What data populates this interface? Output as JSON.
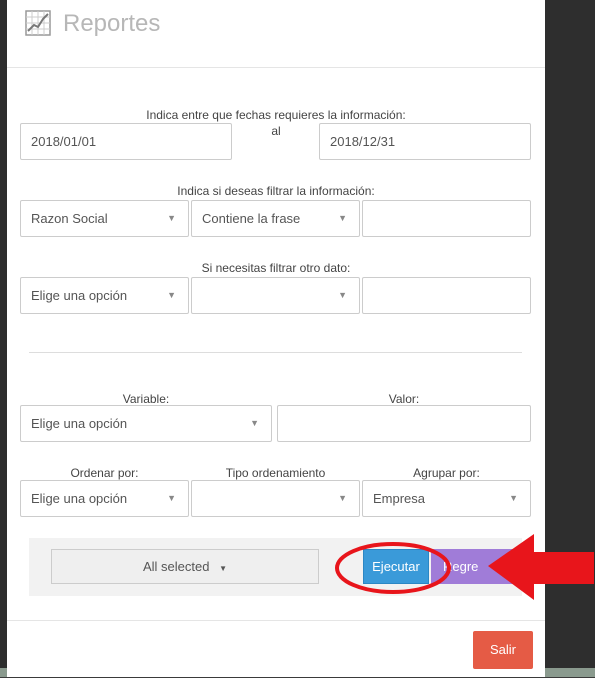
{
  "header": {
    "title": "Reportes",
    "icon": "line-chart-icon"
  },
  "dates": {
    "label": "Indica entre que fechas requieres la información:",
    "separator": "al",
    "start": "2018/01/01",
    "end": "2018/12/31"
  },
  "filter": {
    "label": "Indica si deseas filtrar la información:",
    "field": "Razon Social",
    "condition": "Contiene la frase",
    "value": ""
  },
  "filter2": {
    "label": "Si necesitas filtrar otro dato:",
    "field": "Elige una opción",
    "condition": "",
    "value": ""
  },
  "variable": {
    "label": "Variable:",
    "selected": "Elige una opción"
  },
  "valor": {
    "label": "Valor:",
    "value": ""
  },
  "ordenar": {
    "label": "Ordenar por:",
    "selected": "Elige una opción"
  },
  "tipo_orden": {
    "label": "Tipo ordenamiento",
    "selected": ""
  },
  "agrupar": {
    "label": "Agrupar por:",
    "selected": "Empresa"
  },
  "actions": {
    "multiselect": "All selected",
    "ejecutar": "Ejecutar",
    "regresar": "Regre"
  },
  "footer": {
    "salir": "Salir"
  },
  "colors": {
    "ejecutar": "#3a9ad9",
    "regresar": "#a07cd8",
    "salir": "#e55b45",
    "annotation": "#e8151b"
  }
}
